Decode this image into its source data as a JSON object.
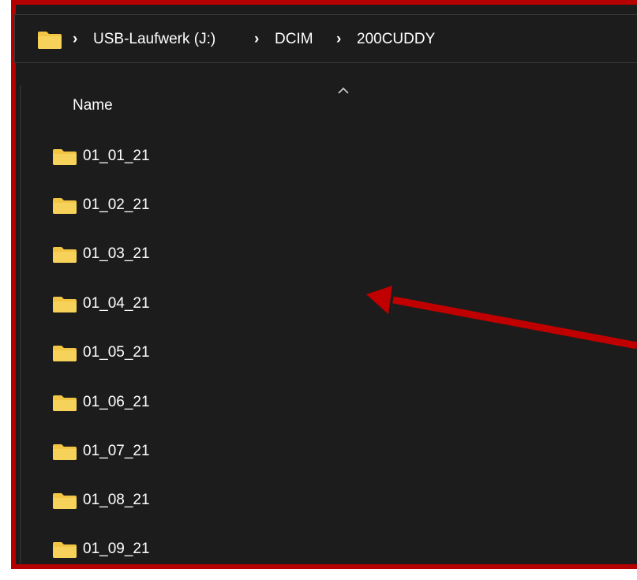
{
  "breadcrumb": {
    "items": [
      {
        "label": "USB-Laufwerk (J:)"
      },
      {
        "label": "DCIM"
      },
      {
        "label": "200CUDDY"
      }
    ],
    "separator": "›"
  },
  "list": {
    "column_header": "Name",
    "rows": [
      {
        "name": "01_01_21"
      },
      {
        "name": "01_02_21"
      },
      {
        "name": "01_03_21"
      },
      {
        "name": "01_04_21"
      },
      {
        "name": "01_05_21"
      },
      {
        "name": "01_06_21"
      },
      {
        "name": "01_07_21"
      },
      {
        "name": "01_08_21"
      },
      {
        "name": "01_09_21"
      }
    ]
  },
  "colors": {
    "window_bg": "#1c1c1c",
    "frame_border": "#b40000",
    "annotation_arrow": "#c00000",
    "folder_icon": "#f3c544",
    "text": "#ffffff"
  },
  "icons": {
    "address_bar": "folder-icon",
    "rows": "folder-icon",
    "sort": "chevron-up-icon"
  }
}
